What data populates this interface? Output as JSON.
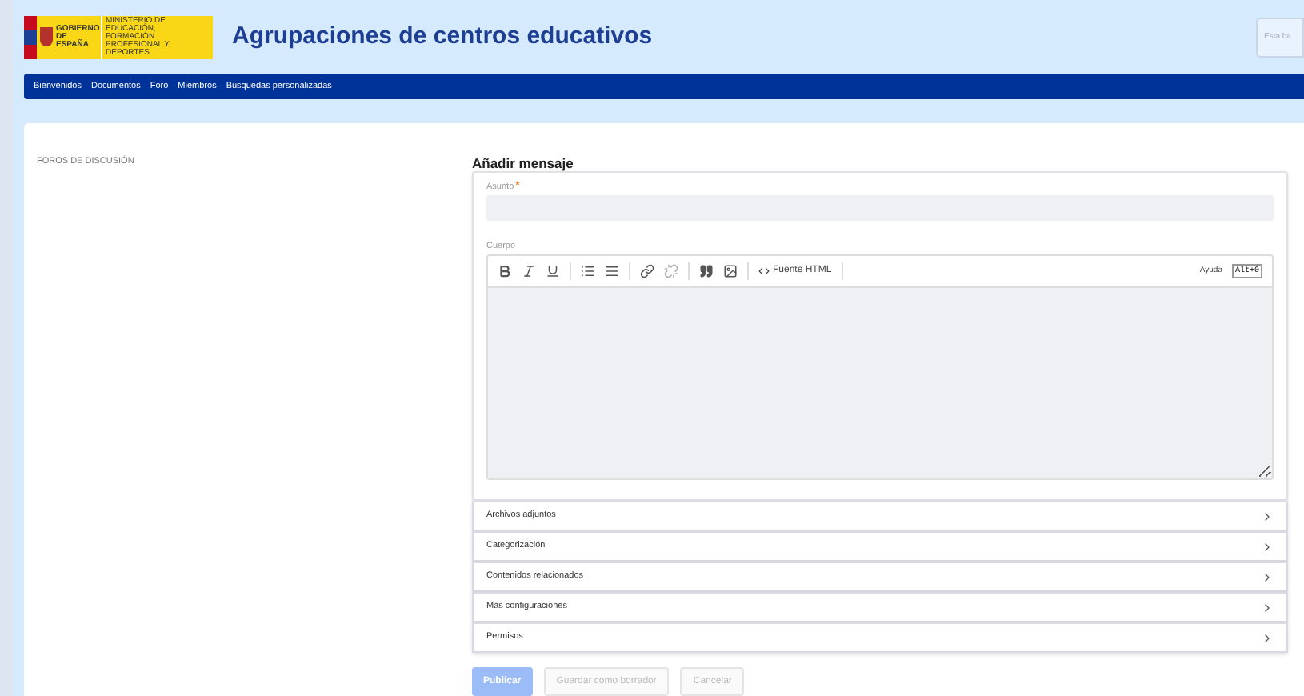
{
  "header": {
    "logo": {
      "line_1": "GOBIERNO DE ESPAÑA",
      "line_2": "MINISTERIO DE EDUCACIÓN, FORMACIÓN PROFESIONAL Y DEPORTES"
    },
    "title": "Agrupaciones de centros educativos",
    "search": {
      "placeholder": "Esta ba"
    }
  },
  "nav": [
    "Bienvenidos",
    "Documentos",
    "Foro",
    "Miembros",
    "Búsquedas personalizadas"
  ],
  "sidebar": {
    "title": "FOROS DE DISCUSIÓN"
  },
  "form": {
    "title": "Añadir mensaje",
    "subject": {
      "label": "Asunto",
      "required_mark": "*"
    },
    "body": {
      "label": "Cuerpo",
      "toolbar": [
        {
          "kind": "bold"
        },
        {
          "kind": "italic"
        },
        {
          "kind": "underline"
        },
        {
          "kind": "sep"
        },
        {
          "kind": "bullets"
        },
        {
          "kind": "numbers"
        },
        {
          "kind": "sep"
        },
        {
          "kind": "link"
        },
        {
          "kind": "unlink"
        },
        {
          "kind": "sep"
        },
        {
          "kind": "quote"
        },
        {
          "kind": "image"
        },
        {
          "kind": "sep"
        },
        {
          "kind": "source",
          "label": "Fuente HTML"
        },
        {
          "kind": "sep"
        }
      ],
      "help": "Ayuda",
      "shortcut": "Alt+0"
    },
    "sections": [
      {
        "label": "Archivos adjuntos",
        "expanded": false
      },
      {
        "label": "Categorización",
        "expanded": false
      },
      {
        "label": "Contenidos relacionados",
        "expanded": false
      },
      {
        "label": "Más configuraciones",
        "expanded": false
      },
      {
        "label": "Permisos",
        "expanded": false
      }
    ],
    "buttons": [
      {
        "label": "Publicar",
        "kind": "primary",
        "disabled": true
      },
      {
        "label": "Guardar como borrador",
        "kind": "secondary",
        "disabled": true
      },
      {
        "label": "Cancelar",
        "kind": "secondary",
        "disabled": true
      }
    ]
  }
}
